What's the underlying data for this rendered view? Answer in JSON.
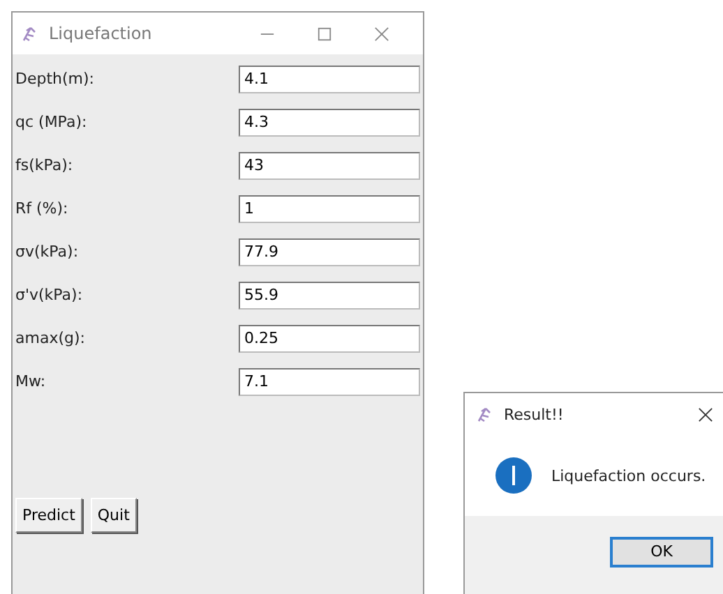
{
  "main_window": {
    "title": "Liquefaction",
    "fields": [
      {
        "label": "Depth(m):",
        "value": "4.1"
      },
      {
        "label": "qc (MPa):",
        "value": "4.3"
      },
      {
        "label": "fs(kPa):",
        "value": "43"
      },
      {
        "label": "Rf (%):",
        "value": "1"
      },
      {
        "label": "σv(kPa):",
        "value": "77.9"
      },
      {
        "label": "σ'v(kPa):",
        "value": "55.9"
      },
      {
        "label": "amax(g):",
        "value": "0.25"
      },
      {
        "label": "Mw:",
        "value": "7.1"
      }
    ],
    "buttons": [
      "Predict",
      "Quit"
    ]
  },
  "dialog": {
    "title": "Result!!",
    "message": "Liquefaction occurs.",
    "button": "OK"
  }
}
